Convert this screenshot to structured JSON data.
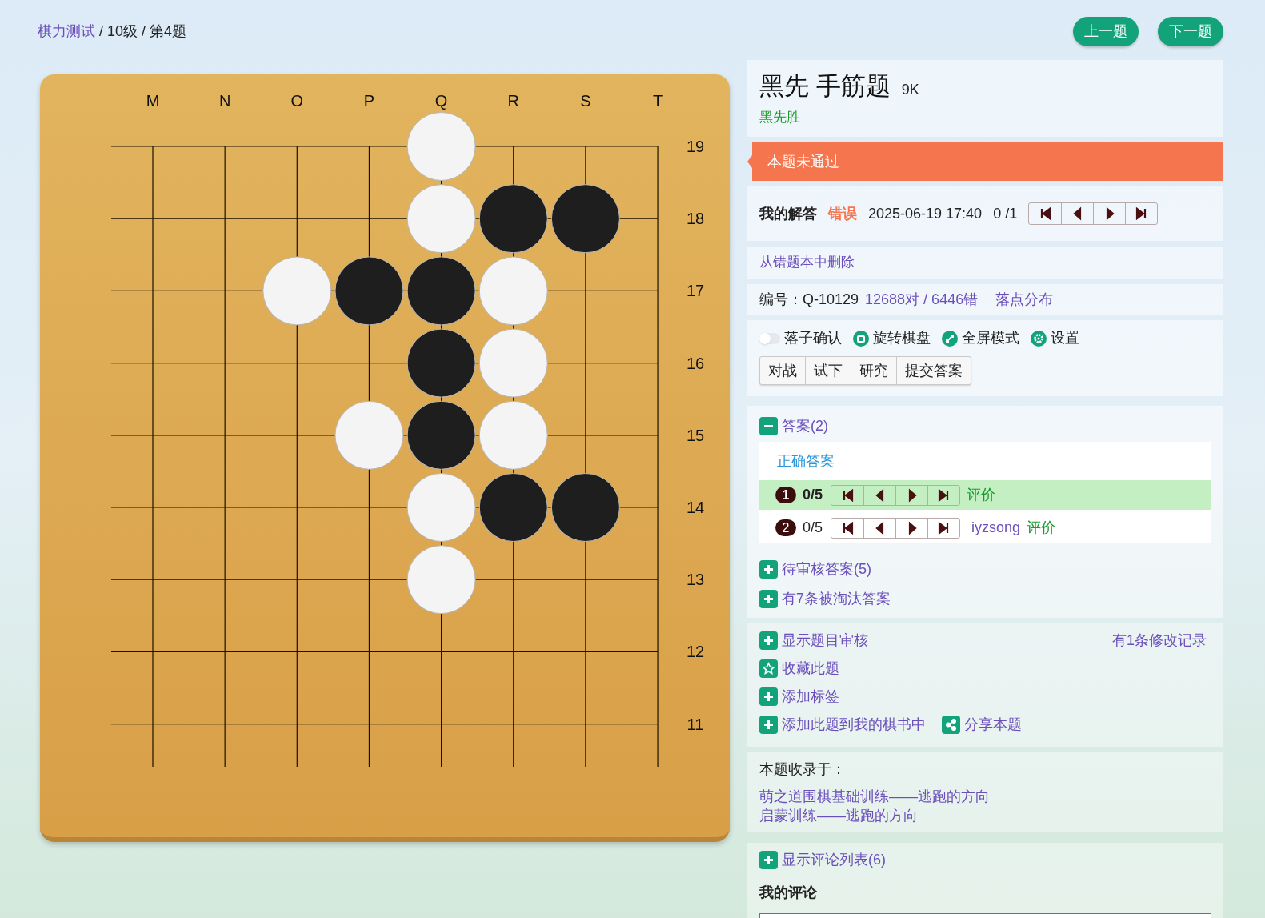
{
  "breadcrumb": [
    {
      "kind": "link",
      "text": "棋力测试"
    },
    {
      "kind": "sep",
      "text": "/"
    },
    {
      "kind": "plain",
      "text": "10级"
    },
    {
      "kind": "sep",
      "text": "/"
    },
    {
      "kind": "plain",
      "text": "第4题"
    }
  ],
  "nav_buttons": [
    "上一题",
    "下一题"
  ],
  "board": {
    "columns": [
      "M",
      "N",
      "O",
      "P",
      "Q",
      "R",
      "S",
      "T"
    ],
    "rows": [
      {
        "label": "19",
        "points": [
          {
            "kind": "empty"
          },
          {
            "kind": "empty"
          },
          {
            "kind": "empty"
          },
          {
            "kind": "empty"
          },
          {
            "kind": "stone",
            "color": "#f4f4f4"
          },
          {
            "kind": "empty"
          },
          {
            "kind": "empty"
          },
          {
            "kind": "empty"
          }
        ]
      },
      {
        "label": "18",
        "points": [
          {
            "kind": "empty"
          },
          {
            "kind": "empty"
          },
          {
            "kind": "empty"
          },
          {
            "kind": "empty"
          },
          {
            "kind": "stone",
            "color": "#f4f4f4"
          },
          {
            "kind": "stone",
            "color": "#1e1e1e"
          },
          {
            "kind": "stone",
            "color": "#1e1e1e"
          },
          {
            "kind": "empty"
          }
        ]
      },
      {
        "label": "17",
        "points": [
          {
            "kind": "empty"
          },
          {
            "kind": "empty"
          },
          {
            "kind": "stone",
            "color": "#f4f4f4"
          },
          {
            "kind": "stone",
            "color": "#1e1e1e"
          },
          {
            "kind": "stone",
            "color": "#1e1e1e"
          },
          {
            "kind": "stone",
            "color": "#f4f4f4"
          },
          {
            "kind": "empty"
          },
          {
            "kind": "empty"
          }
        ]
      },
      {
        "label": "16",
        "points": [
          {
            "kind": "empty"
          },
          {
            "kind": "empty"
          },
          {
            "kind": "empty"
          },
          {
            "kind": "empty"
          },
          {
            "kind": "stone",
            "color": "#1e1e1e"
          },
          {
            "kind": "stone",
            "color": "#f4f4f4"
          },
          {
            "kind": "empty"
          },
          {
            "kind": "empty"
          }
        ]
      },
      {
        "label": "15",
        "points": [
          {
            "kind": "empty"
          },
          {
            "kind": "empty"
          },
          {
            "kind": "empty"
          },
          {
            "kind": "stone",
            "color": "#f4f4f4"
          },
          {
            "kind": "stone",
            "color": "#1e1e1e"
          },
          {
            "kind": "stone",
            "color": "#f4f4f4"
          },
          {
            "kind": "empty"
          },
          {
            "kind": "empty"
          }
        ]
      },
      {
        "label": "14",
        "points": [
          {
            "kind": "empty"
          },
          {
            "kind": "empty"
          },
          {
            "kind": "empty"
          },
          {
            "kind": "empty"
          },
          {
            "kind": "stone",
            "color": "#f4f4f4"
          },
          {
            "kind": "stone",
            "color": "#1e1e1e"
          },
          {
            "kind": "stone",
            "color": "#1e1e1e"
          },
          {
            "kind": "empty"
          }
        ]
      },
      {
        "label": "13",
        "points": [
          {
            "kind": "empty"
          },
          {
            "kind": "empty"
          },
          {
            "kind": "empty"
          },
          {
            "kind": "empty"
          },
          {
            "kind": "stone",
            "color": "#f4f4f4"
          },
          {
            "kind": "empty"
          },
          {
            "kind": "empty"
          },
          {
            "kind": "empty"
          }
        ]
      },
      {
        "label": "12",
        "points": [
          {
            "kind": "empty"
          },
          {
            "kind": "empty"
          },
          {
            "kind": "empty"
          },
          {
            "kind": "empty"
          },
          {
            "kind": "empty"
          },
          {
            "kind": "empty"
          },
          {
            "kind": "empty"
          },
          {
            "kind": "empty"
          }
        ]
      },
      {
        "label": "11",
        "points": [
          {
            "kind": "empty"
          },
          {
            "kind": "empty"
          },
          {
            "kind": "empty"
          },
          {
            "kind": "empty"
          },
          {
            "kind": "empty"
          },
          {
            "kind": "empty"
          },
          {
            "kind": "empty"
          },
          {
            "kind": "empty"
          }
        ]
      }
    ]
  },
  "problem": {
    "title": "黑先 手筋题",
    "level": "9K",
    "goal": "黑先胜"
  },
  "status_banner": "本题未通过",
  "my_answer": {
    "label": "我的解答",
    "result": "错误",
    "time": "2025-06-19 17:40",
    "progress": "0 /1"
  },
  "remove_link": "从错题本中删除",
  "info": {
    "id": "编号：Q-10129",
    "stats": "12688对 / 6446错",
    "distribution": "落点分布"
  },
  "options": [
    {
      "kind": "toggle",
      "label": "落子确认",
      "on": false
    },
    {
      "kind": "rotate",
      "label": "旋转棋盘"
    },
    {
      "kind": "fullscreen",
      "label": "全屏模式"
    },
    {
      "kind": "settings",
      "label": "设置"
    }
  ],
  "modes": [
    "对战",
    "试下",
    "研究",
    "提交答案"
  ],
  "answers": {
    "title": "答案(2)",
    "expanded": true,
    "heading": "正确答案",
    "items": [
      {
        "number": "1",
        "progress": "0/5",
        "selected": true,
        "rate": "评价"
      },
      {
        "number": "2",
        "progress": "0/5",
        "selected": false,
        "author": "iyzsong",
        "rate": "评价"
      }
    ]
  },
  "answer_sections": [
    {
      "label": "待审核答案(5)",
      "expanded": false
    },
    {
      "label": "有7条被淘汰答案",
      "expanded": false
    }
  ],
  "actions": {
    "review": {
      "label": "显示题目审核",
      "expanded": false
    },
    "history": "有1条修改记录",
    "favorite": "收藏此题",
    "tag": "添加标签",
    "add_to_book": "添加此题到我的棋书中",
    "share": "分享本题"
  },
  "collections": {
    "title": "本题收录于：",
    "items": [
      "萌之道围棋基础训练——逃跑的方向",
      "启蒙训练——逃跑的方向"
    ]
  },
  "comments": {
    "toggle": "显示评论列表(6)",
    "expanded": false,
    "my_comment": "我的评论"
  }
}
